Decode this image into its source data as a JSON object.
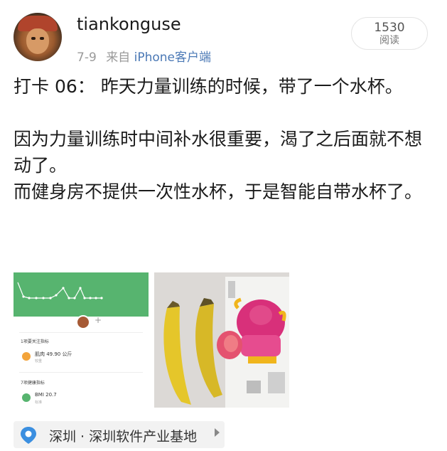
{
  "post": {
    "username": "tiankonguse",
    "date": "7-9",
    "source_prefix": "来自",
    "source": "iPhone客户端",
    "reads": {
      "count": "1530",
      "label": "阅读"
    },
    "text": {
      "line1": "打卡 06： 昨天力量训练的时候，带了一个水杯。",
      "line2": "因为力量训练时中间补水很重要，渴了之后面就不想动了。",
      "line3": "而健身房不提供一次性水杯，于是智能自带水杯了。"
    },
    "images": {
      "health_app": {
        "accent": "#57b46f",
        "section1": "1项要关注指标",
        "metric1": "肌肉 49.90 公斤",
        "metric1_sub": "较重",
        "section2": "7项健康指标",
        "metric2": "BMI 20.7",
        "metric2_sub": "标准"
      }
    },
    "location": "深圳 · 深圳软件产业基地"
  },
  "colors": {
    "link": "#4a78b5",
    "meta": "#9a9a9a"
  }
}
